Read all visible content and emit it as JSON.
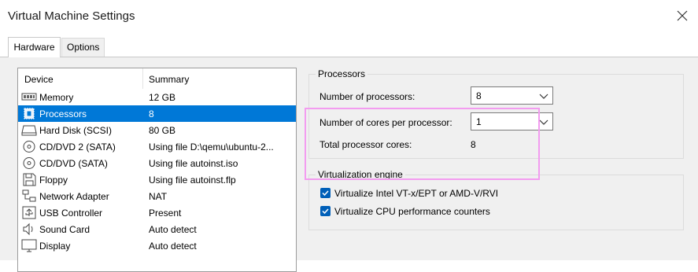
{
  "window": {
    "title": "Virtual Machine Settings"
  },
  "tabs": [
    {
      "label": "Hardware",
      "active": true
    },
    {
      "label": "Options",
      "active": false
    }
  ],
  "devices": {
    "columns": {
      "device": "Device",
      "summary": "Summary"
    },
    "rows": [
      {
        "name": "Memory",
        "summary": "12 GB",
        "icon": "memory-icon",
        "selected": false
      },
      {
        "name": "Processors",
        "summary": "8",
        "icon": "processor-icon",
        "selected": true
      },
      {
        "name": "Hard Disk (SCSI)",
        "summary": "80 GB",
        "icon": "hard-disk-icon",
        "selected": false
      },
      {
        "name": "CD/DVD 2 (SATA)",
        "summary": "Using file D:\\qemu\\ubuntu-2...",
        "icon": "cd-dvd-icon",
        "selected": false
      },
      {
        "name": "CD/DVD (SATA)",
        "summary": "Using file autoinst.iso",
        "icon": "cd-dvd-icon",
        "selected": false
      },
      {
        "name": "Floppy",
        "summary": "Using file autoinst.flp",
        "icon": "floppy-icon",
        "selected": false
      },
      {
        "name": "Network Adapter",
        "summary": "NAT",
        "icon": "network-adapter-icon",
        "selected": false
      },
      {
        "name": "USB Controller",
        "summary": "Present",
        "icon": "usb-icon",
        "selected": false
      },
      {
        "name": "Sound Card",
        "summary": "Auto detect",
        "icon": "sound-icon",
        "selected": false
      },
      {
        "name": "Display",
        "summary": "Auto detect",
        "icon": "display-icon",
        "selected": false
      }
    ]
  },
  "processors": {
    "group_title": "Processors",
    "num_processors_label": "Number of processors:",
    "num_processors_value": "8",
    "cores_label": "Number of cores per processor:",
    "cores_value": "1",
    "total_label": "Total processor cores:",
    "total_value": "8"
  },
  "virtualization": {
    "group_title": "Virtualization engine",
    "options": [
      {
        "label": "Virtualize Intel VT-x/EPT or AMD-V/RVI",
        "checked": true
      },
      {
        "label": "Virtualize CPU performance counters",
        "checked": true
      }
    ]
  },
  "colors": {
    "selection": "#0078d7",
    "checkbox": "#005fb8",
    "highlight": "#f39cf0"
  }
}
